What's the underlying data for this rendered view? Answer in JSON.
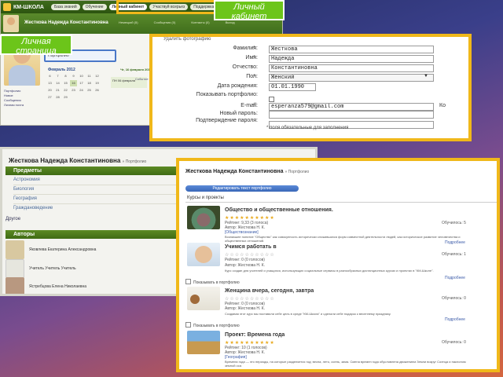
{
  "personal_page": {
    "site_name": "КМ-ШКОЛА",
    "nav_tabs": [
      "База знаний",
      "Обучение",
      "Личный кабинет",
      "Участвуй всерьез",
      "Поддержка"
    ],
    "user_name": "Жесткова Надежда Константиновна",
    "user_links": [
      "Немецкий (5)",
      "Сообщения (0)",
      "Контакты (0)",
      "Выход"
    ],
    "highlighted_link": "Портфолио",
    "calendar_title": "Февраль 2012",
    "calendar_days": [
      "6",
      "7",
      "8",
      "9",
      "10",
      "11",
      "12",
      "13",
      "14",
      "15",
      "16",
      "17",
      "18",
      "19",
      "20",
      "21",
      "22",
      "23",
      "24",
      "25",
      "26",
      "27",
      "28",
      "29",
      "",
      "",
      ""
    ],
    "date_heading": "Чт, 16 февраля 2012",
    "event_text": "ПН 06 февраля",
    "event_label": "Событие",
    "side_links": [
      "Портфолио",
      "Новое",
      "Сообщения",
      "Личная почта"
    ]
  },
  "callouts": {
    "cabinet": "Личный кабинет",
    "personal": "Личная страница"
  },
  "profile_form": {
    "delete_photo": "Удалить фотографию",
    "fields": [
      {
        "label": "Фамилия:",
        "required": "*",
        "value": "Жесткова"
      },
      {
        "label": "Имя:",
        "required": "*",
        "value": "Надежда"
      },
      {
        "label": "Отчество:",
        "required": "",
        "value": "Константиновна"
      },
      {
        "label": "Пол:",
        "required": "*",
        "value": "Женский"
      },
      {
        "label": "Дата рождения:",
        "required": "",
        "value": "01.01.1990"
      },
      {
        "label": "Показывать портфолио:",
        "required": "",
        "value": ""
      },
      {
        "label": "E-mail:",
        "required": "*",
        "value": "esperanza579@gmail.com"
      },
      {
        "label": "Новый пароль:",
        "required": "",
        "value": ""
      },
      {
        "label": "Подтверждение пароля:",
        "required": "",
        "value": ""
      }
    ],
    "email_trailing": "Ко",
    "required_note": "* поля обязательные для заполнения"
  },
  "subjects_page": {
    "title": "Жесткова Надежда Константиновна",
    "breadcrumb": "» Портфолио",
    "subjects_header": "Предметы",
    "subjects": [
      "Астрономия",
      "Биология",
      "География",
      "Граждановедение"
    ],
    "other_label": "Другое",
    "authors_header": "Авторы",
    "authors": [
      "Яковлева Екатерина Александровна",
      "Учитель Учитель Учитель",
      "Ястребцова Елена Николаевна"
    ]
  },
  "portfolio": {
    "title": "Жесткова Надежда Константиновна",
    "breadcrumb": "» Портфолио",
    "edit_button": "Редактировать текст портфолио",
    "tab_label": "Курсы и проекты",
    "add_label": "Показывать в портфолио",
    "more_label": "Подробнее",
    "items": [
      {
        "title": "Общество и общественные отношения.",
        "rating": "Рейтинг: 9,33 (3 голоса)",
        "subject": "[Обществознание]",
        "description": "Возникшее понятие \"Общество\" как совокупность исторически сложившихся форм совместной деятельности людей, как историческое развитие человечества и общественных отношений.",
        "author": "Автор: Жесткова Н. К.",
        "right": "Обучилось: 5"
      },
      {
        "title": "Учимся работать в",
        "rating": "Рейтинг: 0 (0 голосов)",
        "subject": "",
        "description": "Курс создан для учителей и учащихся, использующих социальные сервисы в разнообразных дистанционных курсах и проектах в \"КМ-Школе\".",
        "author": "Автор: Жесткова Н. К.",
        "right": "Обучилось: 1"
      },
      {
        "title": "Женщина вчера, сегодня, завтра",
        "rating": "Рейтинг: 0 (0 голосов)",
        "subject": "",
        "description": "Создавая этот курс мы поставили себе цель в среде \"КМ-Школа\" и сделали себе подарок к весеннему празднику.",
        "author": "Автор: Жесткова Н. К.",
        "right": "Обучилось: 0"
      },
      {
        "title": "Проект: Времена года",
        "rating": "Рейтинг: 10 (1 голосов)",
        "subject": "[География]",
        "description": "Времена года — это периоды, на которые разделяется год: весна, лето, осень, зима. Смена времен года обусловлена движением Земли вокруг Солнца и наклоном земной оси.",
        "author": "Автор: Жесткова Н. К.",
        "right": "Обучилось: 0"
      }
    ]
  }
}
